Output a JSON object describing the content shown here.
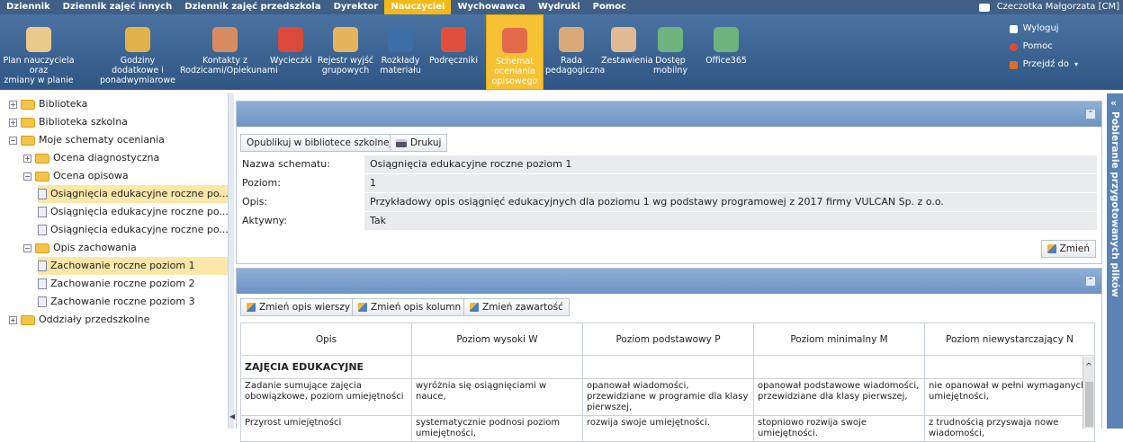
{
  "menu": {
    "items": [
      "Dziennik",
      "Dziennik zajęć innych",
      "Dziennik zajęć przedszkola",
      "Dyrektor",
      "Nauczyciel",
      "Wychowawca",
      "Wydruki",
      "Pomoc"
    ],
    "active_index": 4,
    "user": "Czeczotka Małgorzata [CM]"
  },
  "toolbar": {
    "buttons": [
      {
        "label": "Plan nauczyciela oraz\nzmiany w planie",
        "icon": "teacher-plan-icon",
        "color": "#e9c98c"
      },
      {
        "label": "Godziny dodatkowe i\nponadwymiarowe",
        "icon": "extra-hours-icon",
        "color": "#e2b24a"
      },
      {
        "label": "Kontakty z\nRodzicami/Opiekunami",
        "icon": "parents-contact-icon",
        "color": "#d98c5f"
      },
      {
        "label": "Wycieczki",
        "icon": "backpack-icon",
        "color": "#d94a3a"
      },
      {
        "label": "Rejestr wyjść\ngrupowych",
        "icon": "group-exits-icon",
        "color": "#e5b45c"
      },
      {
        "label": "Rozkłady\nmateriału",
        "icon": "rm-icon",
        "color": "#3c6ea8"
      },
      {
        "label": "Podręczniki",
        "icon": "books-icon",
        "color": "#e04f3c"
      },
      {
        "label": "Schemat oceniania\nopisowego",
        "icon": "grading-scheme-icon",
        "color": "#e36a4a"
      },
      {
        "label": "Rada\npedagogiczna",
        "icon": "council-icon",
        "color": "#d9a877"
      },
      {
        "label": "Zestawienia",
        "icon": "reports-icon",
        "color": "#e2b995"
      },
      {
        "label": "Dostęp\nmobilny",
        "icon": "mobile-access-icon",
        "color": "#6fb37e"
      },
      {
        "label": "Office365",
        "icon": "office365-icon",
        "color": "#6fb37e"
      }
    ],
    "active_index": 7,
    "side": {
      "logout": "Wyloguj",
      "help": "Pomoc",
      "goto": "Przejdź do"
    }
  },
  "tree": [
    {
      "label": "Biblioteka",
      "level": 0,
      "type": "folder",
      "exp": "+"
    },
    {
      "label": "Biblioteka szkolna",
      "level": 0,
      "type": "folder",
      "exp": "+"
    },
    {
      "label": "Moje schematy oceniania",
      "level": 0,
      "type": "folder-open",
      "exp": "−"
    },
    {
      "label": "Ocena diagnostyczna",
      "level": 1,
      "type": "folder",
      "exp": "+"
    },
    {
      "label": "Ocena opisowa",
      "level": 1,
      "type": "folder-open",
      "exp": "−"
    },
    {
      "label": "Osiągnięcia edukacyjne roczne po...",
      "level": 2,
      "type": "doc",
      "selected": true
    },
    {
      "label": "Osiągnięcia edukacyjne roczne po...",
      "level": 2,
      "type": "doc"
    },
    {
      "label": "Osiągnięcia edukacyjne roczne po...",
      "level": 2,
      "type": "doc"
    },
    {
      "label": "Opis zachowania",
      "level": 1,
      "type": "folder-open",
      "exp": "−"
    },
    {
      "label": "Zachowanie roczne poziom 1",
      "level": 2,
      "type": "doc",
      "selected": true
    },
    {
      "label": "Zachowanie roczne poziom 2",
      "level": 2,
      "type": "doc"
    },
    {
      "label": "Zachowanie roczne poziom 3",
      "level": 2,
      "type": "doc"
    },
    {
      "label": "Oddziały przedszkolne",
      "level": 0,
      "type": "folder",
      "exp": "+"
    }
  ],
  "side_panel": {
    "label": "Pobieranie przygotowanych plików"
  },
  "details": {
    "publish_label": "Opublikuj w bibliotece szkolnej",
    "print_label": "Drukuj",
    "fields": [
      {
        "label": "Nazwa schematu:",
        "value": "Osiągnięcia edukacyjne roczne poziom 1"
      },
      {
        "label": "Poziom:",
        "value": "1"
      },
      {
        "label": "Opis:",
        "value": "Przykładowy opis osiągnięć edukacyjnych dla poziomu 1 wg podstawy programowej z 2017 firmy VULCAN Sp. z o.o."
      },
      {
        "label": "Aktywny:",
        "value": "Tak"
      }
    ],
    "change_label": "Zmień"
  },
  "grid_panel": {
    "buttons": [
      "Zmień opis wierszy",
      "Zmień opis kolumn",
      "Zmień zawartość"
    ],
    "columns": [
      "Opis",
      "Poziom wysoki W",
      "Poziom podstawowy P",
      "Poziom minimalny M",
      "Poziom niewystarczający N"
    ],
    "section": "ZAJĘCIA EDUKACYJNE",
    "rows": [
      [
        "Zadanie sumujące zajęcia obowiązkowe, poziom umiejętności",
        "wyróżnia się osiągnięciami w nauce,",
        "opanował wiadomości, przewidziane w programie dla klasy pierwszej,",
        "opanował podstawowe wiadomości, przewidziane dla klasy pierwszej,",
        "nie opanował w pełni wymaganych umiejętności,"
      ],
      [
        "Przyrost umiejętności",
        "systematycznie podnosi poziom umiejętności,",
        "rozwija swoje umiejętności.",
        "stopniowo rozwija swoje umiejętności.",
        "z trudnością przyswaja nowe wiadomości,"
      ]
    ]
  }
}
